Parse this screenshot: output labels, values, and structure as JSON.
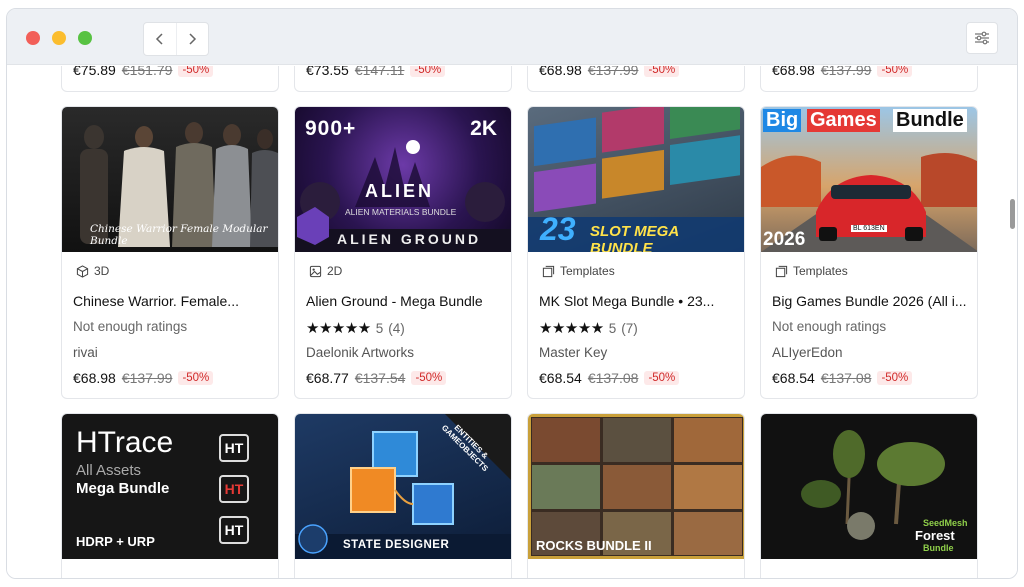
{
  "top_row": [
    {
      "price": "€75.89",
      "old": "€151.79",
      "disc": "-50%"
    },
    {
      "price": "€73.55",
      "old": "€147.11",
      "disc": "-50%"
    },
    {
      "price": "€68.98",
      "old": "€137.99",
      "disc": "-50%"
    },
    {
      "price": "€68.98",
      "old": "€137.99",
      "disc": "-50%"
    }
  ],
  "cards": [
    {
      "category": "3D",
      "category_icon": "cube-icon",
      "name": "Chinese Warrior. Female...",
      "rating_text": "Not enough ratings",
      "publisher": "rivai",
      "price": "€68.98",
      "old": "€137.99",
      "disc": "-50%",
      "thumb_text": "Chinese Warrior Female Modular Bundle"
    },
    {
      "category": "2D",
      "category_icon": "image-icon",
      "name": "Alien Ground - Mega Bundle",
      "stars": "★★★★★",
      "score": "5",
      "count": "(4)",
      "publisher": "Daelonik Artworks",
      "price": "€68.77",
      "old": "€137.54",
      "disc": "-50%",
      "thumb_top_left": "900+",
      "thumb_top_right": "2K",
      "thumb_title": "ALIEN",
      "thumb_sub": "ALIEN MATERIALS BUNDLE",
      "thumb_bottom": "ALIEN GROUND"
    },
    {
      "category": "Templates",
      "category_icon": "template-icon",
      "name": "MK Slot Mega Bundle • 23...",
      "stars": "★★★★★",
      "score": "5",
      "count": "(7)",
      "publisher": "Master Key",
      "price": "€68.54",
      "old": "€137.08",
      "disc": "-50%",
      "thumb_num": "23",
      "thumb_title": "SLOT MEGA BUNDLE"
    },
    {
      "category": "Templates",
      "category_icon": "template-icon",
      "name": "Big Games Bundle 2026 (All i...",
      "rating_text": "Not enough ratings",
      "publisher": "ALIyerEdon",
      "price": "€68.54",
      "old": "€137.08",
      "disc": "-50%",
      "thumb_big": "Big",
      "thumb_games": "Games",
      "thumb_bundle": "Bundle",
      "thumb_year": "2026",
      "thumb_plate": "BL 613EN"
    }
  ],
  "bottom_row": [
    {
      "thumb_title": "HTrace",
      "thumb_sub1": "All Assets",
      "thumb_sub2": "Mega Bundle",
      "thumb_foot": "HDRP + URP",
      "badge": "HT"
    },
    {
      "thumb_corner": "ENTITIES & GAMEOBJECTS",
      "thumb_title": "STATE DESIGNER"
    },
    {
      "thumb_title": "ROCKS BUNDLE II"
    },
    {
      "thumb_brand1": "SeedMesh",
      "thumb_brand2": "Forest",
      "thumb_brand3": "Bundle"
    }
  ],
  "colors": {
    "discount_text": "#d12a2a",
    "discount_bg": "#fde9e9",
    "titlebar": "#edf0f4"
  }
}
